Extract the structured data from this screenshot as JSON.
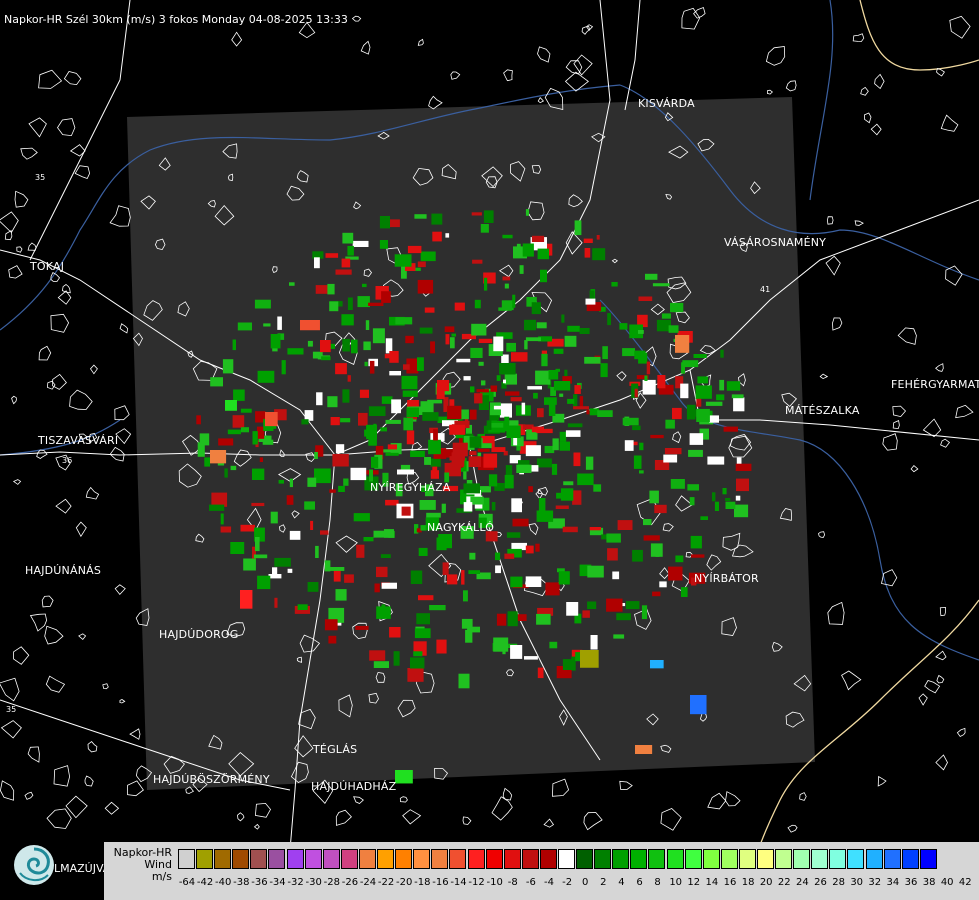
{
  "title": "Napkor-HR Szél 30km (m/s) 3 fokos Monday 04-08-2025 13:33",
  "cities": [
    {
      "name": "KISVÁRDA"
    },
    {
      "name": "VÁSÁROSNAMÉNY"
    },
    {
      "name": "TOKAJ"
    },
    {
      "name": "FEHÉRGYARMAT"
    },
    {
      "name": "MÁTÉSZALKA"
    },
    {
      "name": "TISZAVASVÁRI"
    },
    {
      "name": "NYÍREGYHÁZA"
    },
    {
      "name": "NAGYKÁLLÓ"
    },
    {
      "name": "HAJDÚNÁNÁS"
    },
    {
      "name": "NYÍRBÁTOR"
    },
    {
      "name": "HAJDÚDOROG"
    },
    {
      "name": "TÉGLÁS"
    },
    {
      "name": "HAJDÚBÖSZÖRMÉNY"
    },
    {
      "name": "HAJDÚHADHÁZ"
    }
  ],
  "road_numbers": [
    "35",
    "36",
    "41",
    "35"
  ],
  "legend": {
    "line1": "Napkor-HR",
    "line2": "Wind",
    "line3": "m/s",
    "swatch_colors": [
      "#d0d0d0",
      "#a0a000",
      "#a06a00",
      "#a04a00",
      "#a05050",
      "#9a50a0",
      "#a040f0",
      "#c050e0",
      "#c050c0",
      "#d04080",
      "#f08040",
      "#ffa000",
      "#ff8000",
      "#ff9040",
      "#f08040",
      "#f05030",
      "#ff2020",
      "#f00000",
      "#e01010",
      "#c01010",
      "#b00000",
      "#ffffff",
      "#006000",
      "#008000",
      "#00a000",
      "#00b000",
      "#10c010",
      "#20e020",
      "#40ff40",
      "#80ff40",
      "#a0ff60",
      "#e0ff80",
      "#ffff80",
      "#c0ff90",
      "#a0ffb0",
      "#a0ffd0",
      "#80ffe0",
      "#40e0ff",
      "#20b0ff",
      "#2070ff",
      "#0040ff",
      "#0000ff"
    ],
    "tick_labels": [
      "-64",
      "-42",
      "-40",
      "-38",
      "-36",
      "-34",
      "-32",
      "-30",
      "-28",
      "-26",
      "-24",
      "-22",
      "-20",
      "-18",
      "-16",
      "-14",
      "-12",
      "-10",
      "-8",
      "-6",
      "-4",
      "-2",
      "0",
      "2",
      "4",
      "6",
      "8",
      "10",
      "12",
      "14",
      "16",
      "18",
      "20",
      "22",
      "24",
      "26",
      "28",
      "30",
      "32",
      "34",
      "36",
      "38",
      "40",
      "42"
    ]
  },
  "logo_text": "LMAZÚJVÁR",
  "colors": {
    "radar_area": "#2e2e2e",
    "background": "#000000",
    "roads": "#ffffff",
    "rivers": "#3a5f9f",
    "border": "#f0d9a0"
  }
}
